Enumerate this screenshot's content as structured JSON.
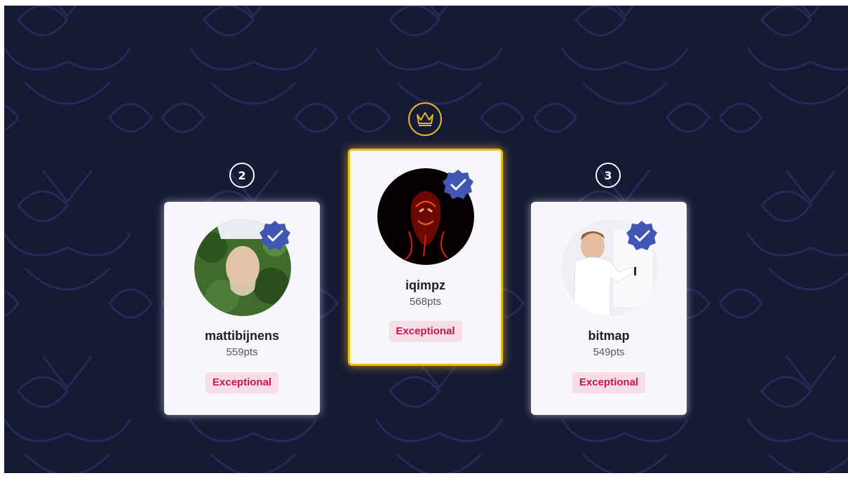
{
  "podium": {
    "second": {
      "rank": "2",
      "username": "mattibijnens",
      "points": "559pts",
      "tag": "Exceptional"
    },
    "first": {
      "username": "iqimpz",
      "points": "568pts",
      "tag": "Exceptional"
    },
    "third": {
      "rank": "3",
      "username": "bitmap",
      "points": "549pts",
      "tag": "Exceptional"
    }
  },
  "colors": {
    "background": "#151a35",
    "card": "#f6f6fb",
    "winner_border": "#f0b818",
    "tag_text": "#c8174f",
    "tag_bg": "#f7dde5",
    "verified": "#4257b2"
  },
  "icons": {
    "crown": "crown-icon",
    "verified": "verified-badge-icon"
  }
}
